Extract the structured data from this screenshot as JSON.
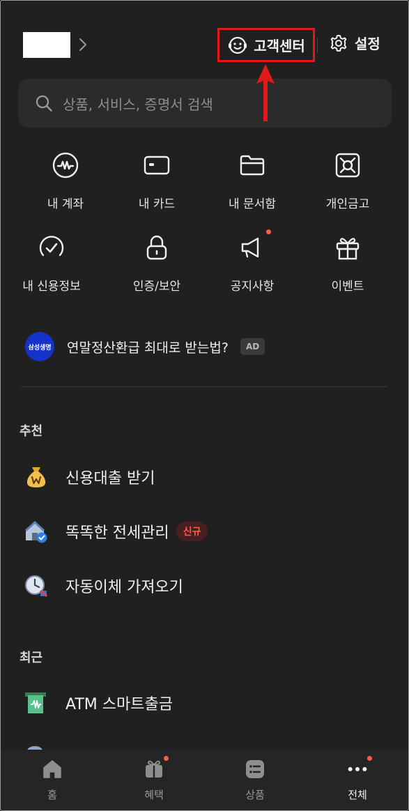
{
  "header": {
    "customer_center_label": "고객센터",
    "settings_label": "설정"
  },
  "search": {
    "placeholder": "상품, 서비스, 증명서 검색"
  },
  "quick_menu": [
    {
      "label": "내 계좌",
      "icon": "account-icon"
    },
    {
      "label": "내 카드",
      "icon": "card-icon"
    },
    {
      "label": "내 문서함",
      "icon": "folder-icon"
    },
    {
      "label": "개인금고",
      "icon": "safe-icon"
    },
    {
      "label": "내 신용정보",
      "icon": "credit-gauge-icon"
    },
    {
      "label": "인증/보안",
      "icon": "lock-icon"
    },
    {
      "label": "공지사항",
      "icon": "megaphone-icon",
      "new_dot": true
    },
    {
      "label": "이벤트",
      "icon": "gift-icon"
    }
  ],
  "ad": {
    "brand_logo_text": "삼성생명",
    "text": "연말정산환급 최대로 받는법?",
    "badge": "AD"
  },
  "recommended": {
    "title": "추천",
    "items": [
      {
        "label": "신용대출 받기",
        "icon": "money-bag-icon"
      },
      {
        "label": "똑똑한 전세관리",
        "icon": "house-check-icon",
        "tag": "신규"
      },
      {
        "label": "자동이체 가져오기",
        "icon": "clock-icon"
      }
    ]
  },
  "recent": {
    "title": "최근",
    "items": [
      {
        "label": "ATM 스마트출금",
        "icon": "atm-icon"
      }
    ]
  },
  "tabbar": [
    {
      "label": "홈",
      "icon": "home-icon"
    },
    {
      "label": "혜택",
      "icon": "gift-box-icon",
      "new_dot": true
    },
    {
      "label": "상품",
      "icon": "list-icon"
    },
    {
      "label": "전체",
      "icon": "more-icon",
      "new_dot": true,
      "active": true
    }
  ],
  "colors": {
    "background": "#202020",
    "highlight_box": "#e01919",
    "notification_dot": "#ff5b4a",
    "ad_logo": "#1433c8"
  }
}
